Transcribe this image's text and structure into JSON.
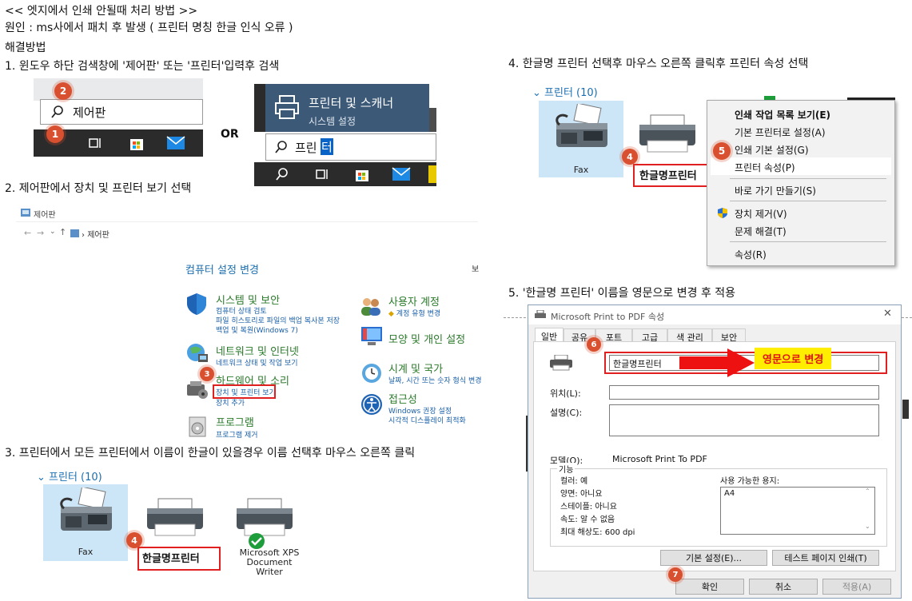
{
  "header": {
    "title": "<< 엣지에서 인쇄 안될때 처리 방법 >>",
    "cause": "원인 :  ms사에서 패치 후 발생 ( 프린터 명칭 한글 인식 오류 )",
    "solution": "해결방법"
  },
  "steps": {
    "s1": "1. 윈도우 하단 검색창에 '제어판' 또는 '프린터'입력후 검색",
    "s2": "2. 제어판에서  장치 및 프린터 보기 선택",
    "s3": "3. 프린터에서 모든 프린터에서 이름이 한글이 있을경우 이름 선택후 마우스 오른쪽 클릭",
    "s4": "4. 한글명 프린터 선택후  마우스 오른쪽 클릭후 프린터 속성 선택",
    "s5": "5. '한글명 프린터' 이름을 영문으로 변경 후 적용"
  },
  "badges": [
    "1",
    "2",
    "3",
    "4",
    "5",
    "6",
    "7"
  ],
  "step1": {
    "search_left_text": "제어판",
    "or_label": "OR",
    "tile_title": "프린터 및 스캐너",
    "tile_sub": "시스템 설정",
    "search_right_text_a": "프린",
    "search_right_text_b": "터"
  },
  "control_panel": {
    "window_title": "제어판",
    "address": "제어판",
    "heading": "컴퓨터 설정 변경",
    "view_by_prefix": "보",
    "items_left": [
      {
        "title": "시스템 및 보안",
        "links": [
          "컴퓨터 상태 검토",
          "파일 히스토리로 파일의 백업 복사본 저장",
          "백업 및 복원(Windows 7)"
        ]
      },
      {
        "title": "네트워크 및 인터넷",
        "links": [
          "네트워크 상태 및 작업 보기"
        ]
      },
      {
        "title": "하드웨어 및 소리",
        "links": [
          "장치 및 프린터 보기",
          "장치 추가"
        ]
      },
      {
        "title": "프로그램",
        "links": [
          "프로그램 제거"
        ]
      }
    ],
    "items_right": [
      {
        "title": "사용자 계정",
        "links": [
          "계정 유형 변경"
        ]
      },
      {
        "title": "모양 및 개인 설정",
        "links": []
      },
      {
        "title": "시계 및 국가",
        "links": [
          "날짜, 시간 또는 숫자 형식 변경"
        ]
      },
      {
        "title": "접근성",
        "links": [
          "Windows 권장 설정",
          "시각적 디스플레이 최적화"
        ]
      }
    ]
  },
  "printers_section": {
    "heading": "프린터 (10)",
    "fax": "Fax",
    "korean_printer": "한글명프린터",
    "xps_line1": "Microsoft XPS",
    "xps_line2": "Document",
    "xps_line3": "Writer"
  },
  "context_menu": {
    "items": [
      "인쇄 작업 목록 보기(E)",
      "기본 프린터로 설정(A)",
      "인쇄 기본 설정(G)",
      "프린터 속성(P)",
      "바로 가기 만들기(S)",
      "장치 제거(V)",
      "문제 해결(T)",
      "속성(R)"
    ]
  },
  "dialog": {
    "title": "Microsoft Print to PDF 속성",
    "tabs": [
      "일반",
      "공유",
      "포트",
      "고급",
      "색 관리",
      "보안"
    ],
    "name_value": "한글명프린터",
    "annotation": "영문으로 변경",
    "location_label": "위치(L):",
    "comment_label": "설명(C):",
    "model_label": "모델(O):",
    "model_value": "Microsoft Print To PDF",
    "features_label": "기능",
    "features": [
      "컬러: 예",
      "양면: 아니요",
      "스테이플: 아니요",
      "속도: 알 수 없음",
      "최대 해상도: 600 dpi"
    ],
    "paper_label": "사용 가능한 용지:",
    "paper_value": "A4",
    "btn_prefs": "기본 설정(E)...",
    "btn_test": "테스트 페이지 인쇄(T)",
    "btn_ok": "확인",
    "btn_cancel": "취소",
    "btn_apply": "적용(A)"
  },
  "colors": {
    "badge": "#d8502f",
    "highlight": "#e02020",
    "annotation_bg": "#ffee00",
    "link_blue": "#1a5fa8"
  }
}
